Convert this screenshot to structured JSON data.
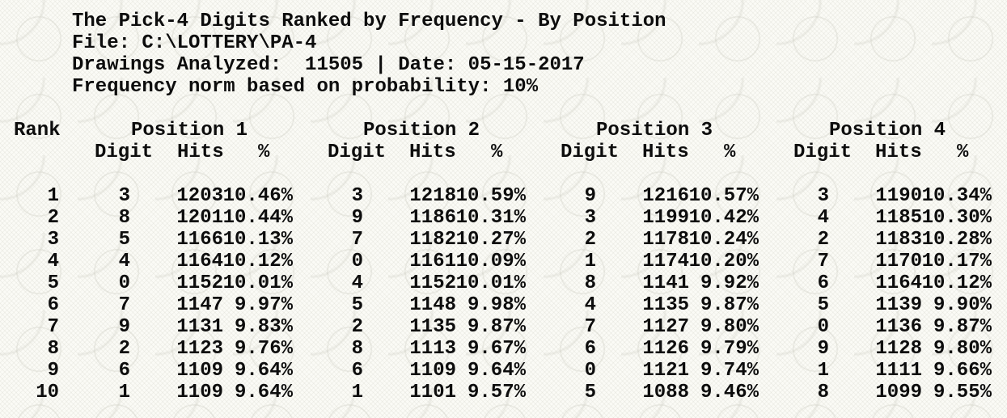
{
  "report": {
    "title": "The Pick-4 Digits Ranked by Frequency - By Position",
    "file_line": "File: C:\\LOTTERY\\PA-4",
    "drawings_line": "Drawings Analyzed:  11505 | Date: 05-15-2017",
    "norm_line": "Frequency norm based on probability: 10%"
  },
  "table": {
    "rank_header": "Rank",
    "column_headers": {
      "digit": "Digit",
      "hits": "Hits",
      "pct": "%"
    },
    "positions": [
      {
        "label": "Position 1",
        "rows": [
          {
            "digit": "3",
            "hits": "1203",
            "pct": "10.46%"
          },
          {
            "digit": "8",
            "hits": "1201",
            "pct": "10.44%"
          },
          {
            "digit": "5",
            "hits": "1166",
            "pct": "10.13%"
          },
          {
            "digit": "4",
            "hits": "1164",
            "pct": "10.12%"
          },
          {
            "digit": "0",
            "hits": "1152",
            "pct": "10.01%"
          },
          {
            "digit": "7",
            "hits": "1147",
            "pct": "9.97%"
          },
          {
            "digit": "9",
            "hits": "1131",
            "pct": "9.83%"
          },
          {
            "digit": "2",
            "hits": "1123",
            "pct": "9.76%"
          },
          {
            "digit": "6",
            "hits": "1109",
            "pct": "9.64%"
          },
          {
            "digit": "1",
            "hits": "1109",
            "pct": "9.64%"
          }
        ]
      },
      {
        "label": "Position 2",
        "rows": [
          {
            "digit": "3",
            "hits": "1218",
            "pct": "10.59%"
          },
          {
            "digit": "9",
            "hits": "1186",
            "pct": "10.31%"
          },
          {
            "digit": "7",
            "hits": "1182",
            "pct": "10.27%"
          },
          {
            "digit": "0",
            "hits": "1161",
            "pct": "10.09%"
          },
          {
            "digit": "4",
            "hits": "1152",
            "pct": "10.01%"
          },
          {
            "digit": "5",
            "hits": "1148",
            "pct": "9.98%"
          },
          {
            "digit": "2",
            "hits": "1135",
            "pct": "9.87%"
          },
          {
            "digit": "8",
            "hits": "1113",
            "pct": "9.67%"
          },
          {
            "digit": "6",
            "hits": "1109",
            "pct": "9.64%"
          },
          {
            "digit": "1",
            "hits": "1101",
            "pct": "9.57%"
          }
        ]
      },
      {
        "label": "Position 3",
        "rows": [
          {
            "digit": "9",
            "hits": "1216",
            "pct": "10.57%"
          },
          {
            "digit": "3",
            "hits": "1199",
            "pct": "10.42%"
          },
          {
            "digit": "2",
            "hits": "1178",
            "pct": "10.24%"
          },
          {
            "digit": "1",
            "hits": "1174",
            "pct": "10.20%"
          },
          {
            "digit": "8",
            "hits": "1141",
            "pct": "9.92%"
          },
          {
            "digit": "4",
            "hits": "1135",
            "pct": "9.87%"
          },
          {
            "digit": "7",
            "hits": "1127",
            "pct": "9.80%"
          },
          {
            "digit": "6",
            "hits": "1126",
            "pct": "9.79%"
          },
          {
            "digit": "0",
            "hits": "1121",
            "pct": "9.74%"
          },
          {
            "digit": "5",
            "hits": "1088",
            "pct": "9.46%"
          }
        ]
      },
      {
        "label": "Position 4",
        "rows": [
          {
            "digit": "3",
            "hits": "1190",
            "pct": "10.34%"
          },
          {
            "digit": "4",
            "hits": "1185",
            "pct": "10.30%"
          },
          {
            "digit": "2",
            "hits": "1183",
            "pct": "10.28%"
          },
          {
            "digit": "7",
            "hits": "1170",
            "pct": "10.17%"
          },
          {
            "digit": "6",
            "hits": "1164",
            "pct": "10.12%"
          },
          {
            "digit": "5",
            "hits": "1139",
            "pct": "9.90%"
          },
          {
            "digit": "0",
            "hits": "1136",
            "pct": "9.87%"
          },
          {
            "digit": "9",
            "hits": "1128",
            "pct": "9.80%"
          },
          {
            "digit": "1",
            "hits": "1111",
            "pct": "9.66%"
          },
          {
            "digit": "8",
            "hits": "1099",
            "pct": "9.55%"
          }
        ]
      }
    ],
    "ranks": [
      "1",
      "2",
      "3",
      "4",
      "5",
      "6",
      "7",
      "8",
      "9",
      "10"
    ]
  }
}
